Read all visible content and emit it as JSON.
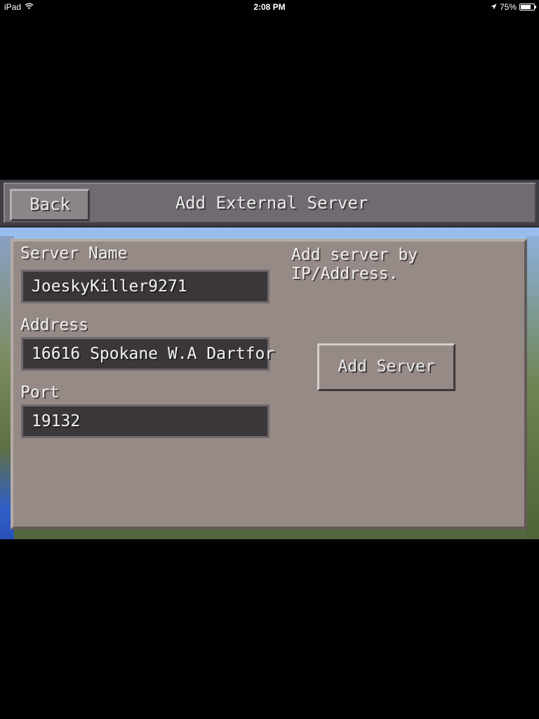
{
  "status_bar": {
    "device": "iPad",
    "time": "2:08 PM",
    "battery_percent": "75%",
    "battery_level": 0.75,
    "icons": [
      "wifi-icon",
      "location-arrow-icon",
      "battery-icon"
    ]
  },
  "header": {
    "back_label": "Back",
    "title": "Add External Server"
  },
  "form": {
    "server_name_label": "Server Name",
    "server_name_value": "JoeskyKiller9271",
    "address_label": "Address",
    "address_value": "16616 Spokane W.A Dartfor",
    "port_label": "Port",
    "port_value": "19132"
  },
  "side": {
    "hint": "Add server by IP/Address.",
    "add_server_label": "Add Server"
  },
  "colors": {
    "panel": "#958a86",
    "field_bg": "#3a3639",
    "header": "#6f6b70",
    "text": "#f0eeee"
  }
}
